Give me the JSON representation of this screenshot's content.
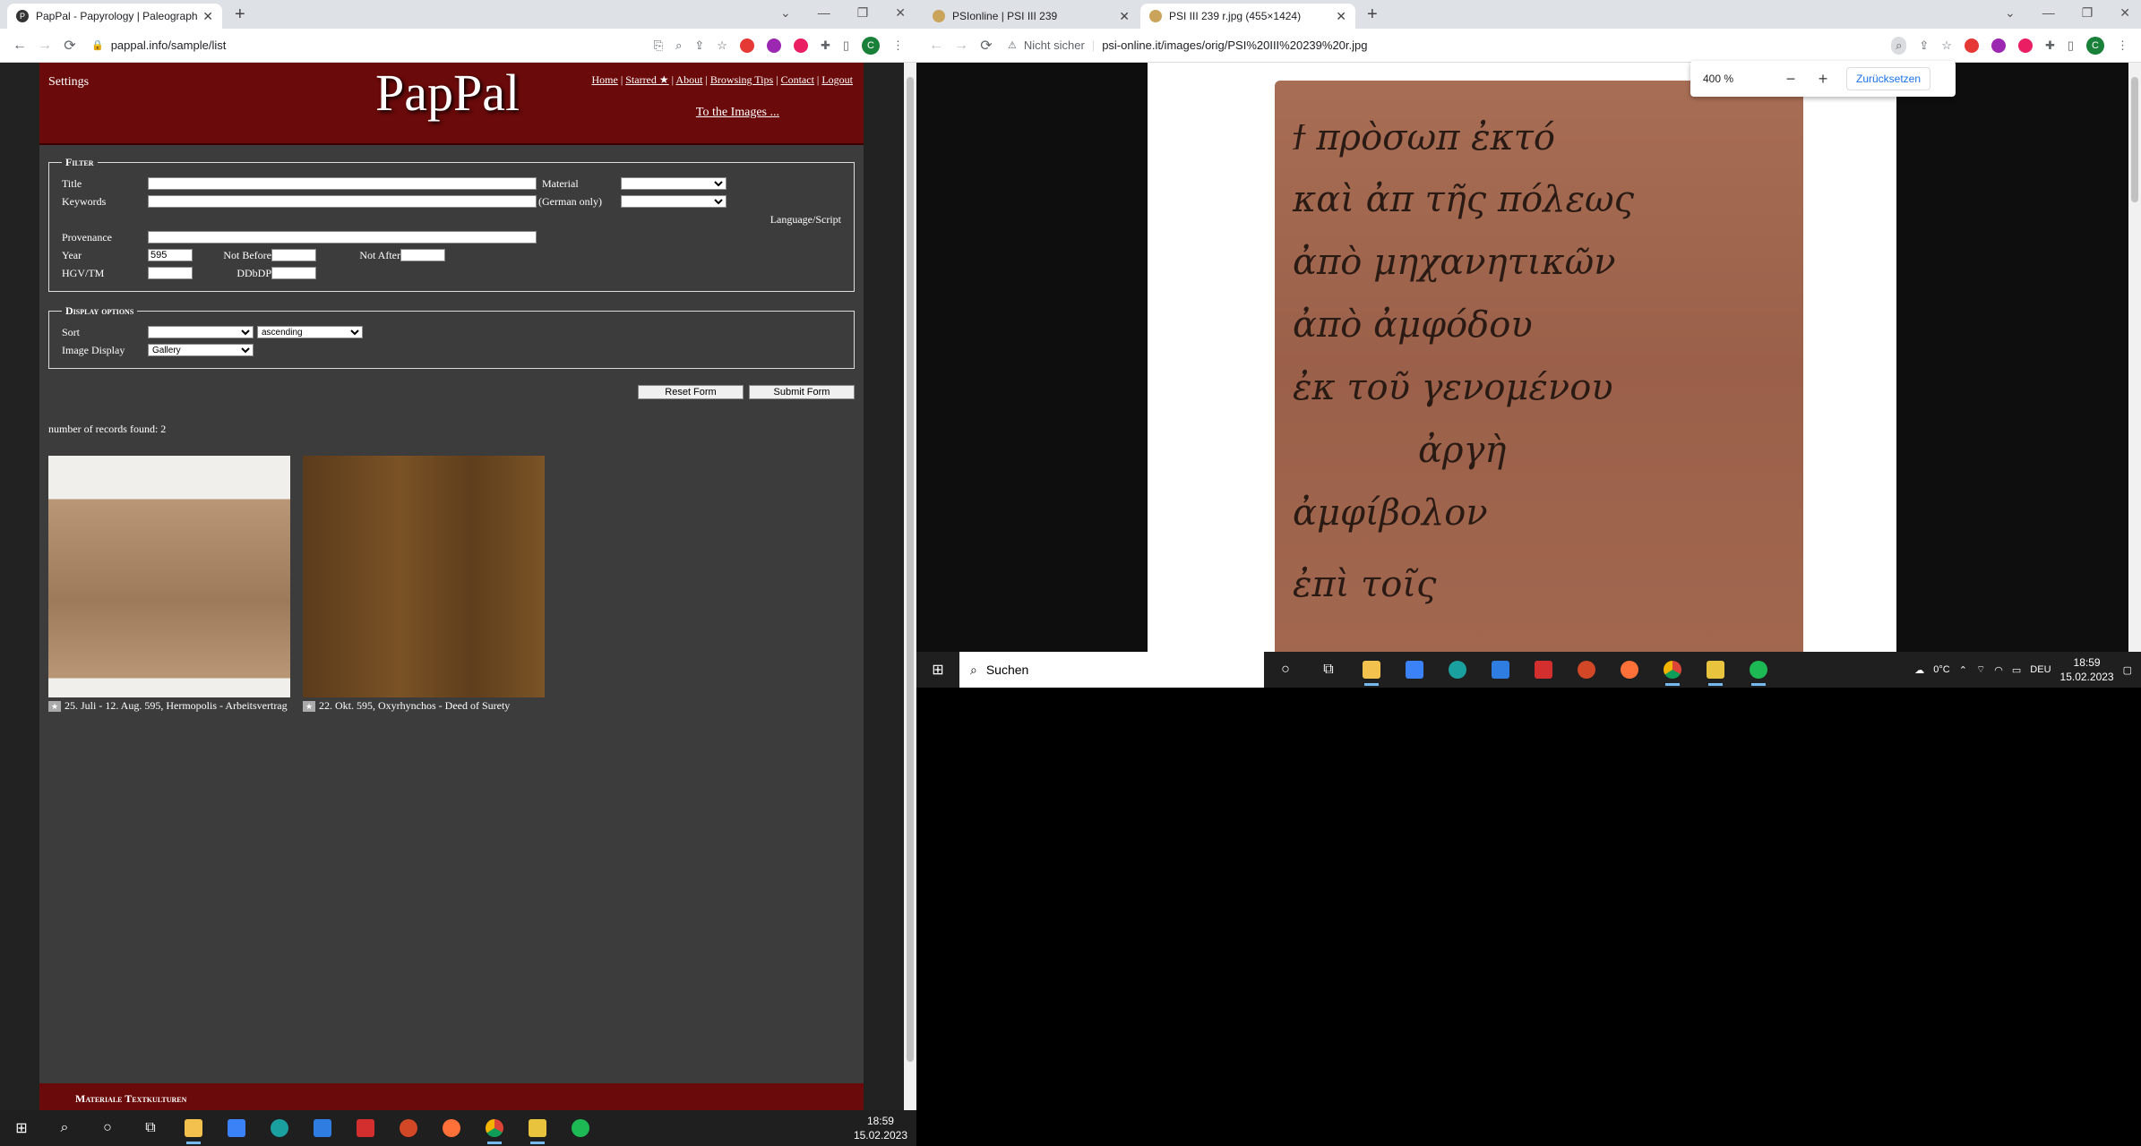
{
  "left_window": {
    "tab": {
      "title": "PapPal - Papyrology | Paleograph...",
      "favicon": "pappal-icon"
    },
    "url": "pappal.info/sample/list",
    "site": {
      "settings": "Settings",
      "logo": "PapPal",
      "nav": [
        "Home",
        "Starred ★",
        "About",
        "Browsing Tips",
        "Contact",
        "Logout"
      ],
      "to_images": "To the Images ...",
      "filter": {
        "legend": "Filter",
        "title_label": "Title",
        "keywords_label": "Keywords",
        "material_label": "Material",
        "german_only": "(German only)",
        "language_label": "Language/Script",
        "provenance_label": "Provenance",
        "year_label": "Year",
        "year_value": "595",
        "not_before_label": "Not Before",
        "not_after_label": "Not After",
        "hgv_label": "HGV/TM",
        "ddbdp_label": "DDbDP"
      },
      "display": {
        "legend": "Display options",
        "sort_label": "Sort",
        "sort_order": "ascending",
        "image_display_label": "Image Display",
        "image_display_value": "Gallery"
      },
      "reset_button": "Reset Form",
      "submit_button": "Submit Form",
      "records": "number of records found: 2",
      "results": [
        {
          "caption": "25. Juli - 12. Aug. 595, Hermopolis - Arbeitsvertrag"
        },
        {
          "caption": "22. Okt. 595, Oxyrhynchos - Deed of Surety"
        }
      ],
      "footer": "Materiale Textkulturen"
    }
  },
  "right_window": {
    "tabs": [
      {
        "title": "PSIonline | PSI III 239"
      },
      {
        "title": "PSI III 239 r.jpg (455×1424)"
      }
    ],
    "security": "Nicht sicher",
    "url": "psi-online.it/images/orig/PSI%20III%20239%20r.jpg",
    "zoom": {
      "value": "400 %",
      "reset": "Zurücksetzen"
    },
    "script_lines": [
      "ϯ πρὸσωπ ἐκτό",
      "καὶ ἀπ τῆς πόλεως",
      "ἀπὸ μηχανητικῶν",
      "ἀπὸ ἀμφόδου",
      "ἐκ τοῦ γενομένου",
      "ἀργὴ",
      "ἀμφίβολον",
      "ἐπὶ τοῖς"
    ]
  },
  "taskbar": {
    "search_placeholder": "Suchen",
    "weather": "0°C",
    "lang": "DEU",
    "time": "18:59",
    "date": "15.02.2023"
  }
}
